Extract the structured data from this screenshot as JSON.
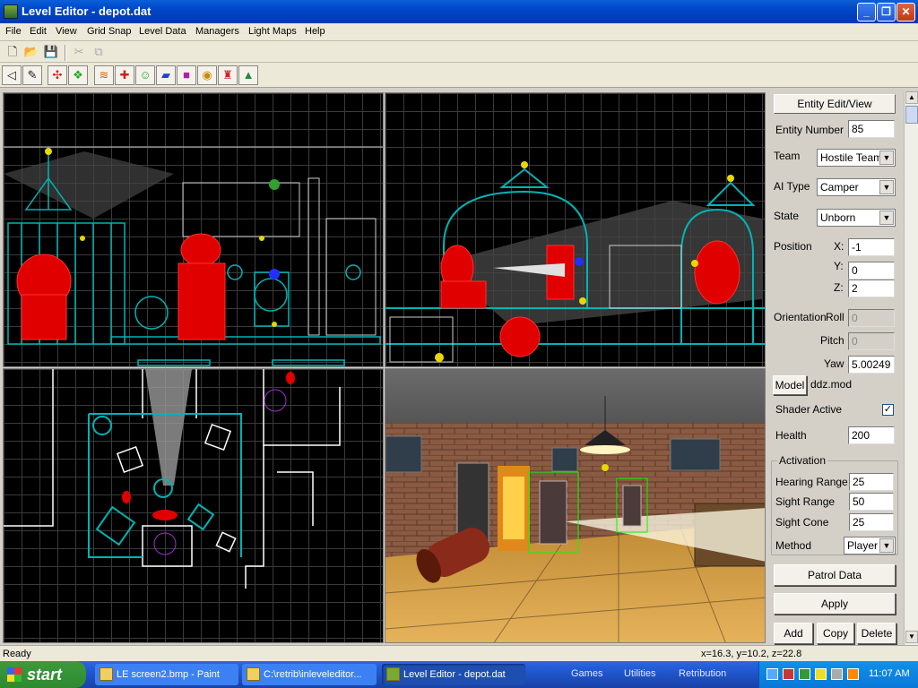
{
  "window": {
    "title": "Level Editor - depot.dat"
  },
  "menu": [
    "File",
    "Edit",
    "View",
    "Grid Snap",
    "Level Data",
    "Managers",
    "Light Maps",
    "Help"
  ],
  "panel": {
    "header": "Entity Edit/View",
    "entity_number_label": "Entity Number",
    "entity_number": "85",
    "team_label": "Team",
    "team": "Hostile Team",
    "ai_type_label": "AI Type",
    "ai_type": "Camper",
    "state_label": "State",
    "state": "Unborn",
    "position_label": "Position",
    "x_label": "X:",
    "x": "-1",
    "y_label": "Y:",
    "y": "0",
    "z_label": "Z:",
    "z": "2",
    "orientation_label": "Orientation",
    "roll_label": "Roll",
    "roll": "0",
    "pitch_label": "Pitch",
    "pitch": "0",
    "yaw_label": "Yaw",
    "yaw": "5.00249",
    "model_button": "Model",
    "model": "ddz.mod",
    "shader_active_label": "Shader Active",
    "shader_active_mark": "✓",
    "health_label": "Health",
    "health": "200",
    "activation_label": "Activation",
    "hearing_range_label": "Hearing Range",
    "hearing_range": "25",
    "sight_range_label": "Sight Range",
    "sight_range": "50",
    "sight_cone_label": "Sight Cone",
    "sight_cone": "25",
    "method_label": "Method",
    "method": "Player",
    "patrol_button": "Patrol Data",
    "apply_button": "Apply",
    "add_button": "Add",
    "copy_button": "Copy",
    "delete_button": "Delete"
  },
  "status": {
    "left": "Ready",
    "coords": "x=16.3, y=10.2, z=22.8"
  },
  "taskbar": {
    "start": "start",
    "tasks": [
      "LE screen2.bmp - Paint",
      "C:\\retrib\\inleveleditor...",
      "Level Editor - depot.dat"
    ],
    "quicklaunch": [
      "Games",
      "Utilities",
      "Retribution"
    ],
    "clock": "11:07 AM"
  },
  "colors": {
    "wireframe": "#00b4b4",
    "enemy": "#ff0000",
    "grid": "#3a3a3a",
    "title_blue": "#0046c8"
  }
}
